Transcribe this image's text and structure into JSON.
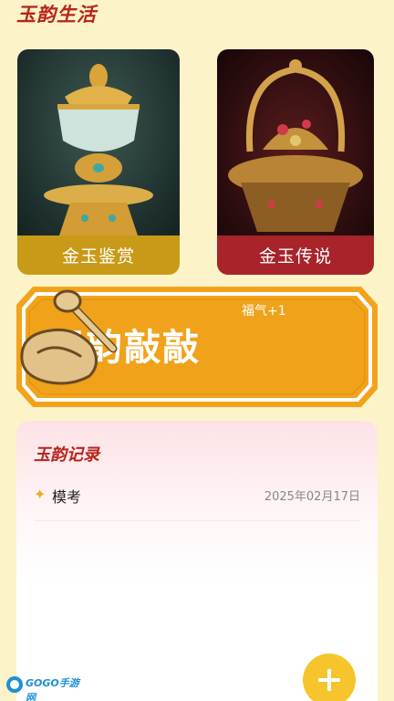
{
  "header": {
    "title": "玉韵生活"
  },
  "cards": [
    {
      "label": "金玉鉴赏",
      "image": "gold-jade-goblet"
    },
    {
      "label": "金玉传说",
      "image": "gold-jeweled-ornament"
    }
  ],
  "banner": {
    "title": "玉韵敲敲",
    "bonus": "福气+1",
    "icon": "wooden-fish-icon"
  },
  "records": {
    "title": "玉韵记录",
    "items": [
      {
        "name": "模考",
        "date": "2025年02月17日"
      }
    ]
  },
  "fab": {
    "icon": "plus-icon"
  },
  "watermark": {
    "text": "GOGO手游网"
  },
  "colors": {
    "background": "#fcf3c8",
    "accent_red": "#b8241c",
    "gold": "#c99a18",
    "banner_orange": "#f0a21a",
    "fab_yellow": "#f6c52c"
  }
}
